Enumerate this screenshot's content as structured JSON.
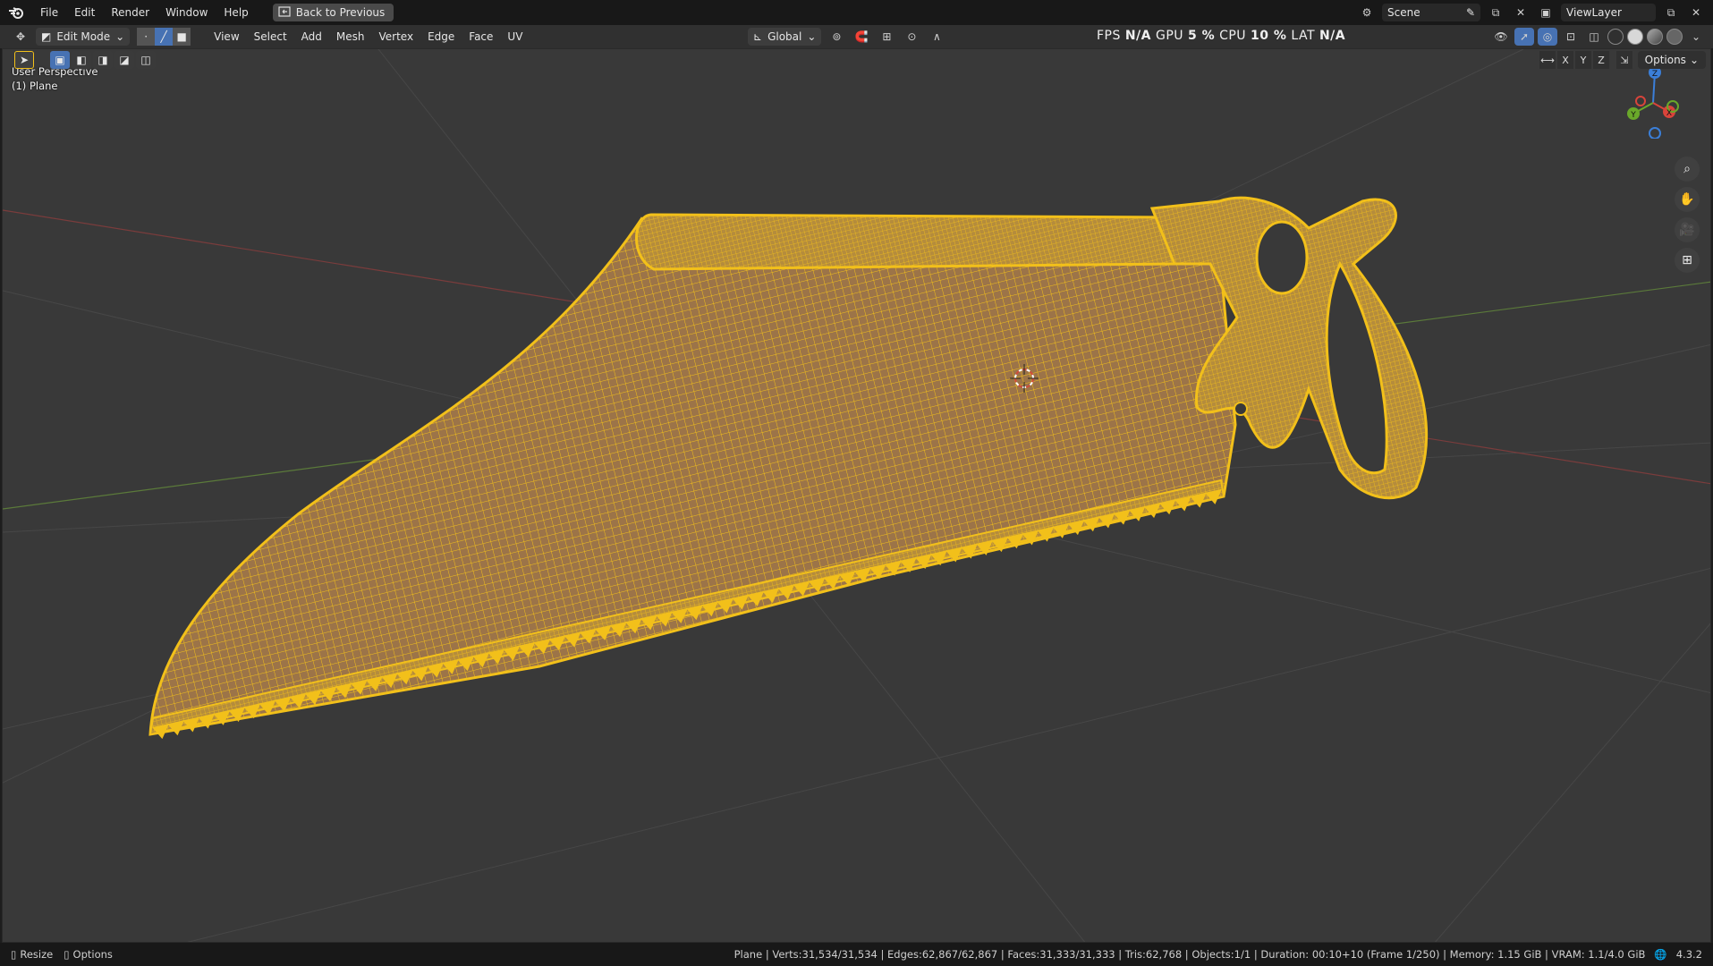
{
  "topbar": {
    "menu": [
      "File",
      "Edit",
      "Render",
      "Window",
      "Help"
    ],
    "back_label": "Back to Previous",
    "scene_label": "Scene",
    "viewlayer_label": "ViewLayer"
  },
  "header": {
    "mode_label": "Edit Mode",
    "menus": [
      "View",
      "Select",
      "Add",
      "Mesh",
      "Vertex",
      "Edge",
      "Face",
      "UV"
    ],
    "orientation_label": "Global",
    "perf": {
      "fps_label": "FPS",
      "fps_value": "N/A",
      "gpu_label": "GPU",
      "gpu_value": "5 %",
      "cpu_label": "CPU",
      "cpu_value": "10 %",
      "lat_label": "LAT",
      "lat_value": "N/A"
    }
  },
  "toolrow": {
    "options_label": "Options",
    "axes": [
      "X",
      "Y",
      "Z"
    ]
  },
  "viewport": {
    "view_name": "User Perspective",
    "object_name": "(1) Plane",
    "gizmo": {
      "z": "Z",
      "y": "Y",
      "x": "X"
    },
    "selection_color": "#f2c01a",
    "background_color": "#393939"
  },
  "statusbar": {
    "resize_label": "Resize",
    "options_label": "Options",
    "stats": "Plane | Verts:31,534/31,534 | Edges:62,867/62,867 | Faces:31,333/31,333 | Tris:62,768 | Objects:1/1 | Duration: 00:10+10 (Frame 1/250) | Memory: 1.15 GiB | VRAM: 1.1/4.0 GiB",
    "version": "4.3.2"
  }
}
